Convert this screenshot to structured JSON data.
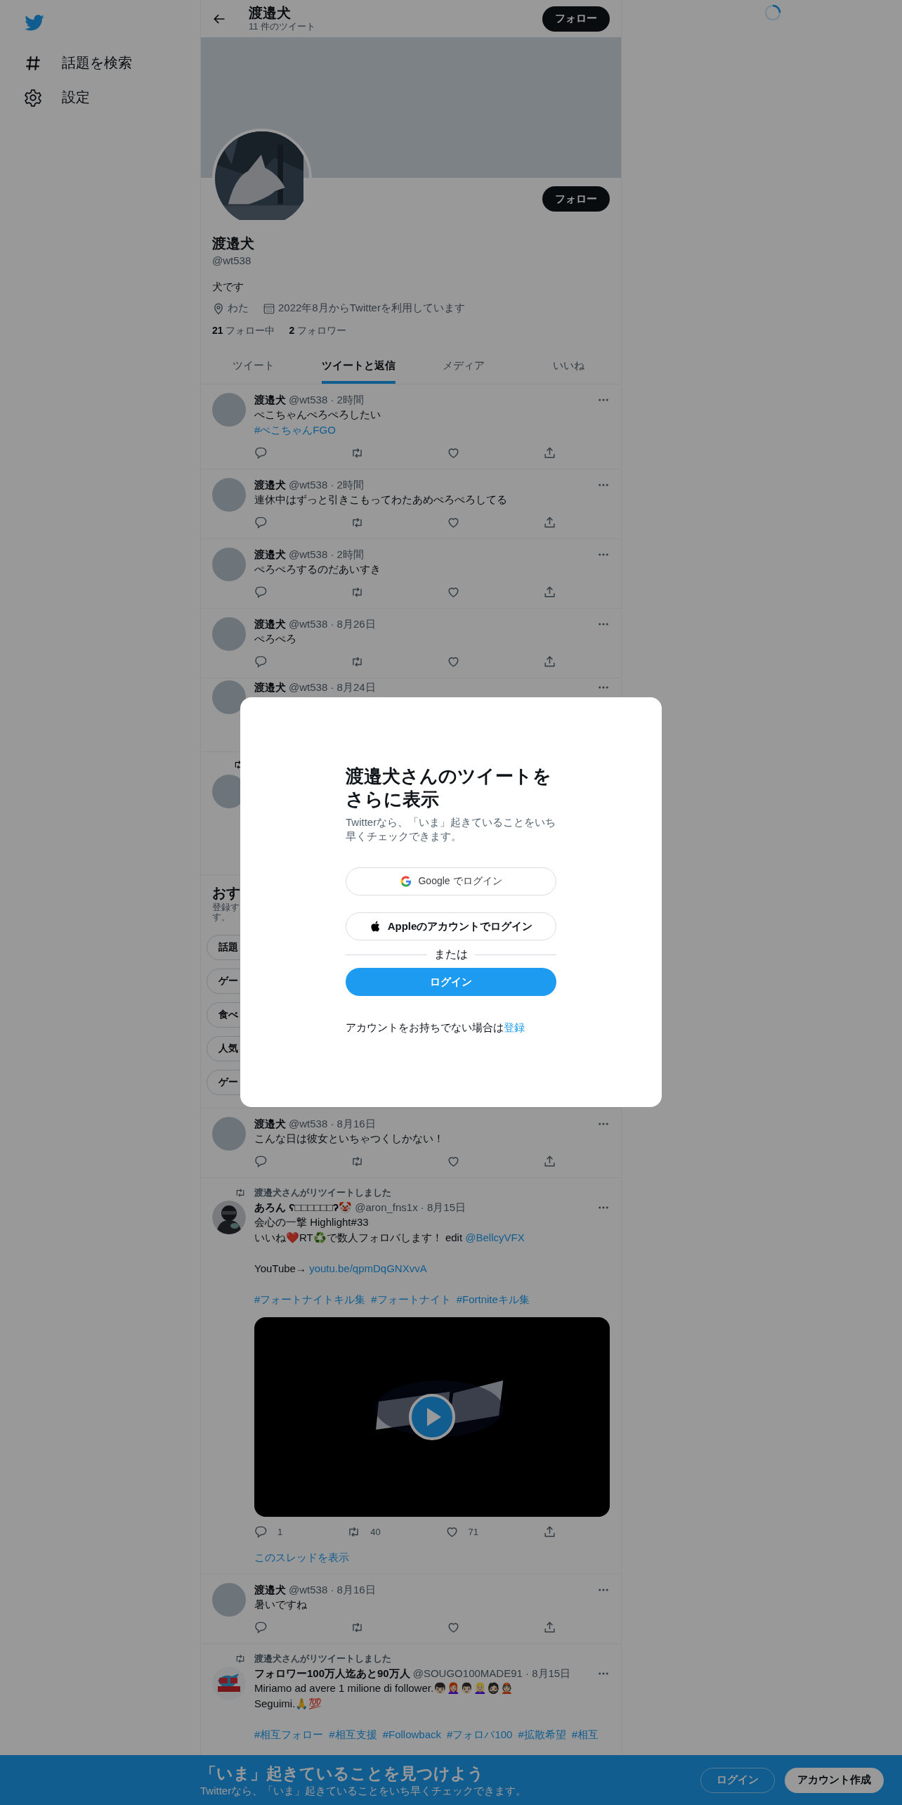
{
  "sidebar": {
    "items": [
      {
        "label": "話題を検索"
      },
      {
        "label": "設定"
      }
    ]
  },
  "header": {
    "title": "渡邉犬",
    "subtitle": "11 件のツイート",
    "follow_button": "フォロー"
  },
  "profile": {
    "follow_button": "フォロー",
    "name": "渡邉犬",
    "handle": "@wt538",
    "bio": "犬です",
    "location": "わた",
    "joined": "2022年8月からTwitterを利用しています",
    "following_count": "21",
    "following_label": "フォロー中",
    "followers_count": "2",
    "followers_label": "フォロワー"
  },
  "tabs": [
    {
      "label": "ツイート",
      "selected": false
    },
    {
      "label": "ツイートと返信",
      "selected": true
    },
    {
      "label": "メディア",
      "selected": false
    },
    {
      "label": "いいね",
      "selected": false
    }
  ],
  "timeline": [
    {
      "kind": "tweet",
      "avatar": {
        "kind": "plain"
      },
      "name": "渡邉犬",
      "meta": "@wt538 · 2時間",
      "paragraphs": [
        {
          "lines": [
            {
              "parts": [
                {
                  "kind": "text",
                  "text": "ぺこちゃんぺろぺろしたい"
                }
              ]
            },
            {
              "parts": [
                {
                  "kind": "link",
                  "text": "#ぺこちゃんFGO"
                }
              ]
            }
          ]
        }
      ]
    },
    {
      "kind": "tweet",
      "avatar": {
        "kind": "plain"
      },
      "name": "渡邉犬",
      "meta": "@wt538 · 2時間",
      "paragraphs": [
        {
          "lines": [
            {
              "parts": [
                {
                  "kind": "text",
                  "text": "連休中はずっと引きこもってわたあめぺろぺろしてる"
                }
              ]
            }
          ]
        }
      ]
    },
    {
      "kind": "tweet",
      "avatar": {
        "kind": "plain"
      },
      "name": "渡邉犬",
      "meta": "@wt538 · 2時間",
      "paragraphs": [
        {
          "lines": [
            {
              "parts": [
                {
                  "kind": "text",
                  "text": "ぺろぺろするのだあいすき"
                }
              ]
            }
          ]
        }
      ]
    },
    {
      "kind": "tweet",
      "avatar": {
        "kind": "plain"
      },
      "name": "渡邉犬",
      "meta": "@wt538 · 8月26日",
      "paragraphs": [
        {
          "lines": [
            {
              "parts": [
                {
                  "kind": "text",
                  "text": "ぺろぺろ"
                }
              ]
            }
          ]
        }
      ]
    },
    {
      "kind": "partial_tweet",
      "name": "渡邉犬",
      "meta": "@wt538 · 8月24日"
    },
    {
      "kind": "hidden_retweet"
    },
    {
      "kind": "suggestions",
      "title": "おす",
      "subtitle_lines": [
        "登録す",
        "す。"
      ],
      "pills": [
        "話題",
        "ゲー",
        "食べ",
        "人気",
        "ゲー"
      ]
    },
    {
      "kind": "tweet",
      "avatar": {
        "kind": "plain"
      },
      "name": "渡邉犬",
      "meta": "@wt538 · 8月16日",
      "paragraphs": [
        {
          "lines": [
            {
              "parts": [
                {
                  "kind": "text",
                  "text": "こんな日は彼女といちゃつくしかない！"
                }
              ]
            }
          ]
        }
      ]
    },
    {
      "kind": "tweet",
      "avatar": {
        "kind": "picture"
      },
      "retweeted_by": "渡邉犬さんがリツイートしました",
      "name": "あろん ʕ□□□□□□ʔ🤡",
      "meta": "@aron_fns1x · 8月15日",
      "paragraphs": [
        {
          "lines": [
            {
              "parts": [
                {
                  "kind": "text",
                  "text": "会心の一撃 Highlight#33"
                }
              ]
            },
            {
              "parts": [
                {
                  "kind": "text",
                  "text": "いいね❤️RT♻️で数人フォロバします！ edit "
                },
                {
                  "kind": "link",
                  "text": "@BellcyVFX"
                }
              ]
            }
          ]
        },
        {
          "lines": [
            {
              "parts": [
                {
                  "kind": "text",
                  "text": "YouTube→ "
                },
                {
                  "kind": "link",
                  "text": "youtu.be/qpmDqGNXvvA"
                }
              ]
            }
          ]
        },
        {
          "lines": [
            {
              "parts": [
                {
                  "kind": "link",
                  "text": "#フォートナイトキル集"
                },
                {
                  "kind": "link",
                  "text": "#フォートナイト"
                },
                {
                  "kind": "link",
                  "text": "#Fortniteキル集"
                }
              ]
            }
          ]
        }
      ],
      "media": {
        "kind": "video"
      },
      "stats": {
        "replies": "1",
        "retweets": "40",
        "likes": "71"
      },
      "thread_link": "このスレッドを表示"
    },
    {
      "kind": "tweet",
      "avatar": {
        "kind": "plain"
      },
      "name": "渡邉犬",
      "meta": "@wt538 · 8月16日",
      "paragraphs": [
        {
          "lines": [
            {
              "parts": [
                {
                  "kind": "text",
                  "text": "暑いですね"
                }
              ]
            }
          ]
        }
      ]
    },
    {
      "kind": "tweet",
      "avatar": {
        "kind": "picture"
      },
      "retweeted_by": "渡邉犬さんがリツイートしました",
      "name": "フォロワー100万人迄あと90万人",
      "meta": "@SOUGO100MADE91 · 8月15日",
      "paragraphs": [
        {
          "lines": [
            {
              "parts": [
                {
                  "kind": "text",
                  "text": "Miriamo ad avere 1 milione di follower.👦🏻👩🏻‍🦰👨🏻👱🏻‍♀️🧔🏻👲🏻"
                }
              ]
            },
            {
              "parts": [
                {
                  "kind": "text",
                  "text": "Seguimi.🙏💯"
                }
              ]
            }
          ]
        },
        {
          "lines": [
            {
              "parts": [
                {
                  "kind": "link",
                  "text": "#相互フォロー"
                },
                {
                  "kind": "link",
                  "text": "#相互支援"
                },
                {
                  "kind": "link",
                  "text": "#Followback"
                },
                {
                  "kind": "link",
                  "text": "#フォロバ100"
                },
                {
                  "kind": "link",
                  "text": "#拡散希望"
                },
                {
                  "kind": "link",
                  "text": "#相互"
                }
              ]
            }
          ]
        }
      ]
    }
  ],
  "modal": {
    "title": "渡邉犬さんのツイートをさらに表示",
    "subtitle": "Twitterなら、「いま」起きていることをいち早くチェックできます。",
    "google_button": "Google でログイン",
    "apple_button": "Appleのアカウントでログイン",
    "divider": "または",
    "login_button": "ログイン",
    "footer": "アカウントをお持ちでない場合は",
    "signup_link": "登録"
  },
  "bottom_bar": {
    "title": "「いま」起きていることを見つけよう",
    "subtitle": "Twitterなら、「いま」起きていることをいち早くチェックできます。",
    "login_button": "ログイン",
    "signup_button": "アカウント作成"
  }
}
